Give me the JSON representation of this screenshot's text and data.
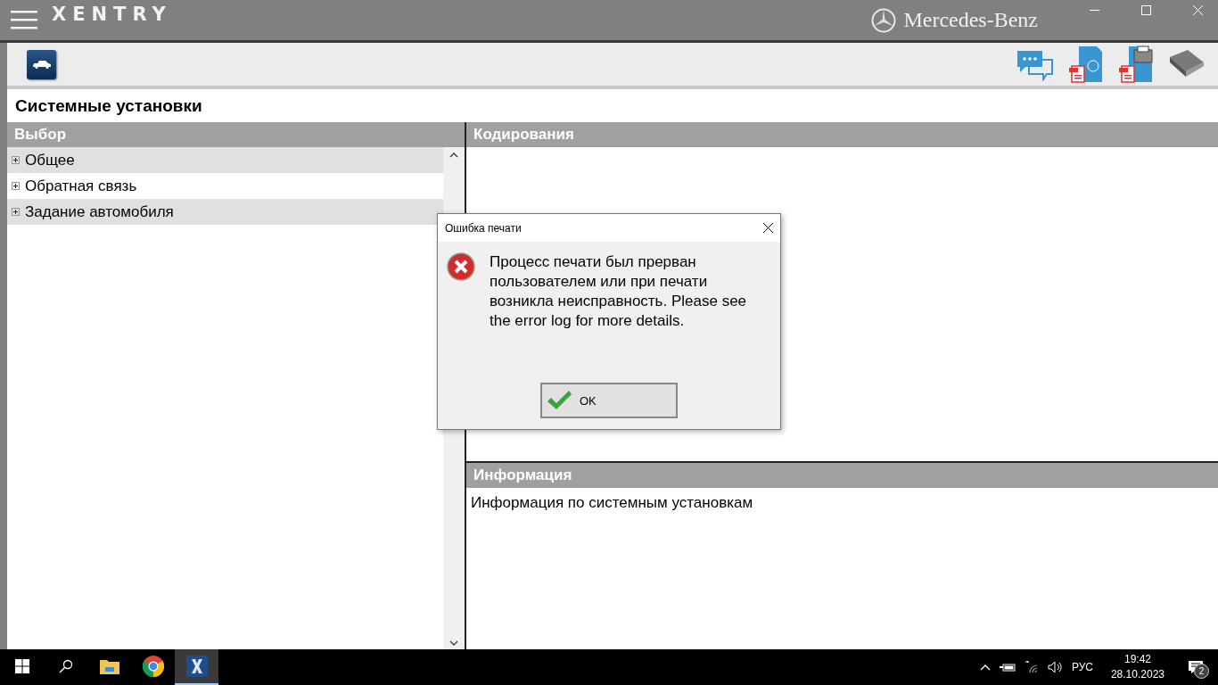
{
  "app_bar": {
    "logo": "XENTRY",
    "brand": "Mercedes-Benz"
  },
  "page_title": "Системные установки",
  "selection_panel": {
    "title": "Выбор",
    "items": [
      {
        "label": "Общее",
        "expanded": false
      },
      {
        "label": "Обратная связь",
        "expanded": false
      },
      {
        "label": "Задание автомобиля",
        "expanded": false
      }
    ]
  },
  "coding_panel": {
    "title": "Кодирования"
  },
  "info_panel": {
    "title": "Информация",
    "text": "Информация по системным установкам"
  },
  "dialog": {
    "title": "Ошибка печати",
    "message": "Процесс печати был прерван пользователем или при печати возникла неисправность. Please see the error log for more details.",
    "button": "OK"
  },
  "taskbar": {
    "apps": [
      {
        "kind": "folder",
        "selected": false
      },
      {
        "kind": "browser",
        "selected": false
      },
      {
        "kind": "xentry",
        "selected": true
      }
    ],
    "language": "РУС",
    "time": "19:42",
    "date": "28.10.2023",
    "notifications": "2"
  }
}
